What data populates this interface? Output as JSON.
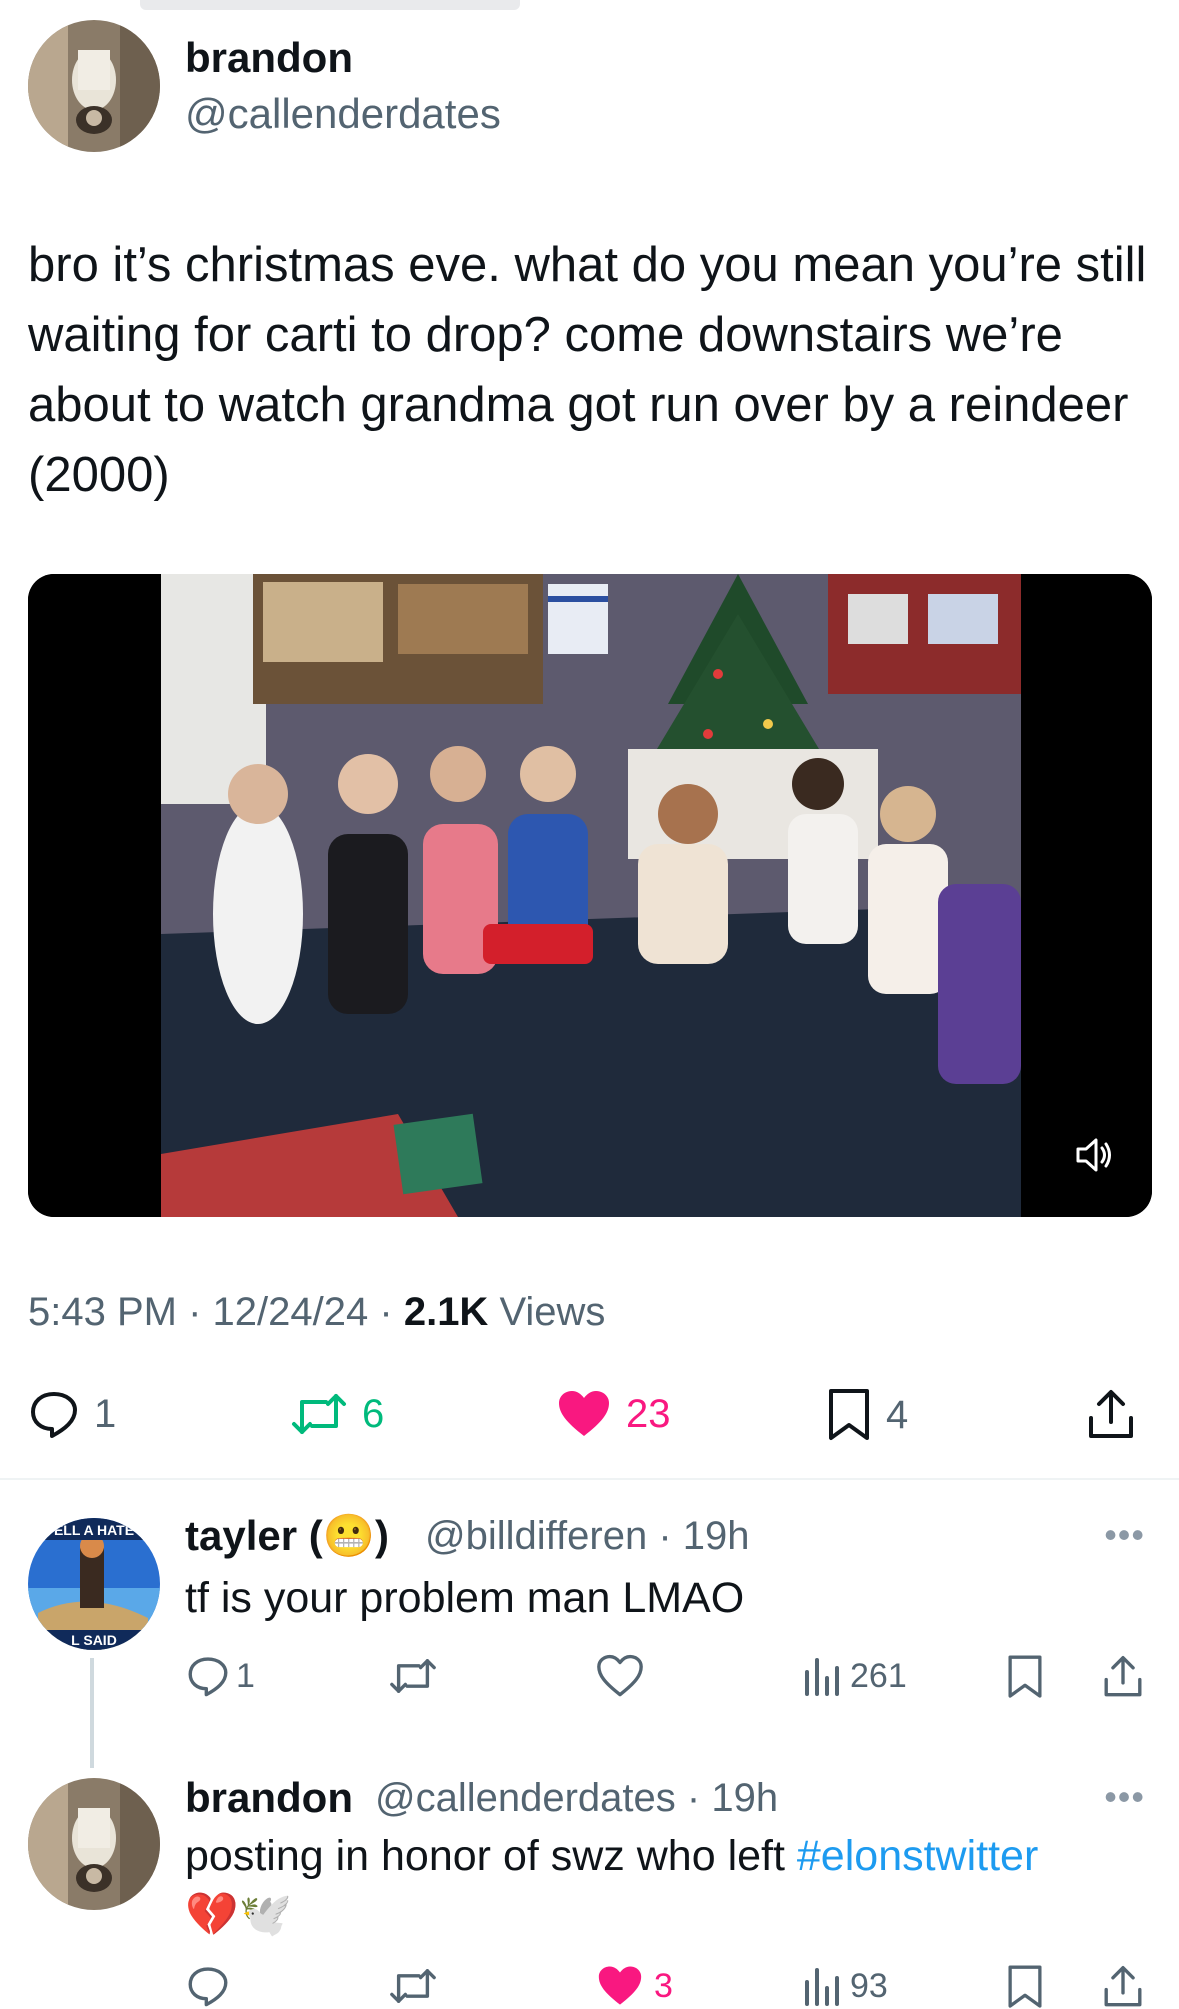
{
  "post": {
    "author": {
      "name": "brandon",
      "handle": "@callenderdates"
    },
    "text": "bro it’s christmas eve. what do you mean you’re still waiting for carti to drop? come downstairs we’re about to watch grandma got run over by a reindeer (2000)",
    "meta": {
      "time": "5:43 PM",
      "date": "12/24/24",
      "views_count": "2.1K",
      "views_label": "Views",
      "sep": "·"
    },
    "stats": {
      "replies": "1",
      "reposts": "6",
      "likes": "23",
      "bookmarks": "4"
    },
    "media": {
      "type": "video",
      "muted": false
    }
  },
  "replies": [
    {
      "name": "tayler (",
      "emoji": "😬",
      "name_close": ")",
      "handle": "@billdifferen",
      "age": "· 19h",
      "text": "tf is your problem man LMAO",
      "avatar_text_top": "ELL A HATE",
      "avatar_text_bottom": "L SAID",
      "stats": {
        "replies": "1",
        "views": "261"
      }
    },
    {
      "name": "brandon",
      "handle": "@callenderdates",
      "age": "· 19h",
      "text_before": "posting in honor of swz who left ",
      "hashtag": "#elonstwitter",
      "emojis": "💔🕊️",
      "stats": {
        "likes": "3",
        "views": "93"
      }
    }
  ],
  "more_label": "•••",
  "colors": {
    "like": "#f91880",
    "repost": "#00ba7c",
    "link": "#1d9bf0",
    "muted": "#536471"
  }
}
